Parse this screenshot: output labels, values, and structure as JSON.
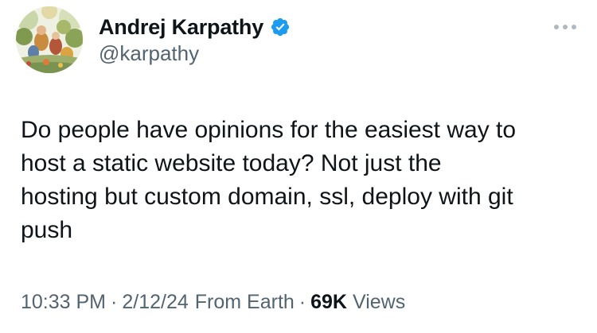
{
  "author": {
    "display_name": "Andrej Karpathy",
    "handle": "@karpathy",
    "verified": true,
    "verified_color": "#1d9bf0"
  },
  "icons": {
    "avatar": "avatar-illustration",
    "verified": "verified-badge-icon",
    "more": "more-horizontal-icon"
  },
  "tweet": {
    "text": "Do people have opinions for the easiest way to\nhost a static website today? Not just the\nhosting but custom domain, ssl, deploy with git\npush"
  },
  "meta": {
    "time": "10:33 PM",
    "separator": "·",
    "date": "2/12/24",
    "location": "From Earth",
    "views_count": "69K",
    "views_label": "Views"
  },
  "colors": {
    "text_primary": "#0f1419",
    "text_secondary": "#536471",
    "more_dots": "#b0b8bf"
  }
}
